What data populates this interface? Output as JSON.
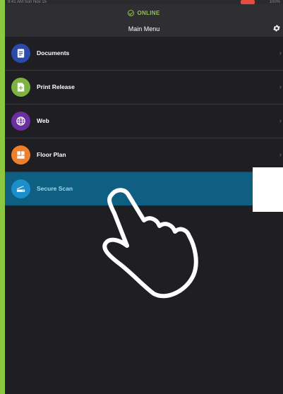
{
  "status_bar": {
    "left_text": "9:41 AM  Sun Nov 15",
    "right_text": "100%"
  },
  "header": {
    "online_label": "ONLINE",
    "title": "Main Menu"
  },
  "menu": {
    "items": [
      {
        "label": "Documents",
        "color": "#2c4aa8",
        "icon": "document-icon"
      },
      {
        "label": "Print Release",
        "color": "#7cb342",
        "icon": "print-release-icon"
      },
      {
        "label": "Web",
        "color": "#6a2fa0",
        "icon": "globe-icon"
      },
      {
        "label": "Floor Plan",
        "color": "#f07f2b",
        "icon": "floor-plan-icon"
      },
      {
        "label": "Secure Scan",
        "color": "#1a8fc9",
        "icon": "scanner-icon",
        "selected": true
      }
    ]
  },
  "colors": {
    "accent": "#8dc63f",
    "selected_row": "#0f5f82",
    "background": "#1f1e22"
  }
}
